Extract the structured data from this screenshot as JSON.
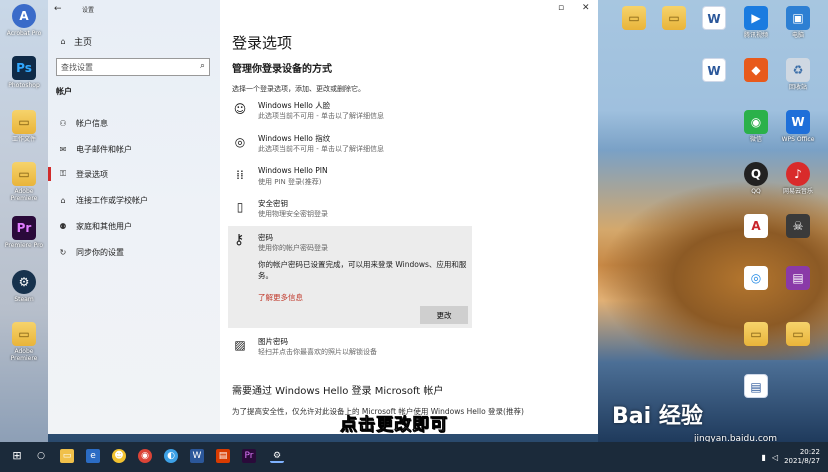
{
  "window": {
    "title": "设置",
    "back_label": "←",
    "home_label": "主页",
    "search_placeholder": "查找设置",
    "section_label": "帐户",
    "nav_items": [
      {
        "label": "帐户信息",
        "icon": "person-icon"
      },
      {
        "label": "电子邮件和帐户",
        "icon": "mail-icon"
      },
      {
        "label": "登录选项",
        "icon": "key-icon",
        "active": true
      },
      {
        "label": "连接工作或学校帐户",
        "icon": "briefcase-icon"
      },
      {
        "label": "家庭和其他用户",
        "icon": "family-icon"
      },
      {
        "label": "同步你的设置",
        "icon": "sync-icon"
      }
    ]
  },
  "content": {
    "page_title": "登录选项",
    "subheading": "管理你登录设备的方式",
    "description": "选择一个登录选项，添加、更改或删除它。",
    "options": [
      {
        "title": "Windows Hello 人脸",
        "subtitle": "此选项当前不可用 - 单击以了解详细信息",
        "icon": "face-icon"
      },
      {
        "title": "Windows Hello 指纹",
        "subtitle": "此选项当前不可用 - 单击以了解详细信息",
        "icon": "fingerprint-icon"
      },
      {
        "title": "Windows Hello PIN",
        "subtitle": "使用 PIN 登录(推荐)",
        "icon": "pin-keypad-icon"
      },
      {
        "title": "安全密钥",
        "subtitle": "使用物理安全密钥登录",
        "icon": "usb-key-icon"
      }
    ],
    "password": {
      "title": "密码",
      "subtitle": "使用你的帐户密码登录",
      "info": "你的帐户密码已设置完成，可以用来登录 Windows、应用和服务。",
      "link": "了解更多信息",
      "button": "更改"
    },
    "picture_password": {
      "title": "图片密码",
      "subtitle": "轻扫并点击你最喜欢的照片以解锁设备"
    },
    "hello_heading": "需要通过 Windows Hello 登录 Microsoft 帐户",
    "hello_desc": "为了提高安全性，仅允许对此设备上的 Microsoft 帐户使用 Windows Hello 登录(推荐)"
  },
  "overlay_subtitle": "点击更改即可",
  "watermark": {
    "brand": "Bai 经验",
    "url": "jingyan.baidu.com"
  },
  "desktop_icons_left": [
    {
      "label": "Acrobat Pro",
      "icon": "acrobat-icon"
    },
    {
      "label": "Photoshop",
      "icon": "photoshop-icon"
    },
    {
      "label": "工作文件",
      "icon": "folder-icon"
    },
    {
      "label": "Adobe Premiere",
      "icon": "folder-icon"
    },
    {
      "label": "Premiere Pro",
      "icon": "premiere-icon"
    },
    {
      "label": "Steam",
      "icon": "steam-icon"
    },
    {
      "label": "Adobe Premiere",
      "icon": "folder-icon"
    }
  ],
  "desktop_icons_right": [
    {
      "label": "",
      "icon": "folder-icon"
    },
    {
      "label": "",
      "icon": "folder-icon"
    },
    {
      "label": "",
      "icon": "word-icon"
    },
    {
      "label": "腾讯视频",
      "icon": "video-icon"
    },
    {
      "label": "电脑",
      "icon": "computer-icon"
    },
    {
      "label": "",
      "icon": "word-icon"
    },
    {
      "label": "",
      "icon": "word-icon"
    },
    {
      "label": "",
      "icon": "app-icon"
    },
    {
      "label": "回收站",
      "icon": "recycle-bin-icon"
    },
    {
      "label": "微信",
      "icon": "wechat-icon"
    },
    {
      "label": "WPS Office",
      "icon": "wps-icon"
    },
    {
      "label": "QQ",
      "icon": "qq-icon"
    },
    {
      "label": "网易云音乐",
      "icon": "music-icon"
    },
    {
      "label": "",
      "icon": "autocad-icon"
    },
    {
      "label": "",
      "icon": "pirate-icon"
    },
    {
      "label": "",
      "icon": "app-icon"
    },
    {
      "label": "",
      "icon": "winrar-icon"
    },
    {
      "label": "",
      "icon": "folder-icon"
    },
    {
      "label": "",
      "icon": "folder-icon"
    },
    {
      "label": "",
      "icon": "doc-icon"
    }
  ],
  "taskbar": {
    "time": "20:22",
    "date": "2021/8/27"
  },
  "colors": {
    "accent": "#d02b2b",
    "link": "#c0392b",
    "taskbar": "#1b2a3a"
  }
}
